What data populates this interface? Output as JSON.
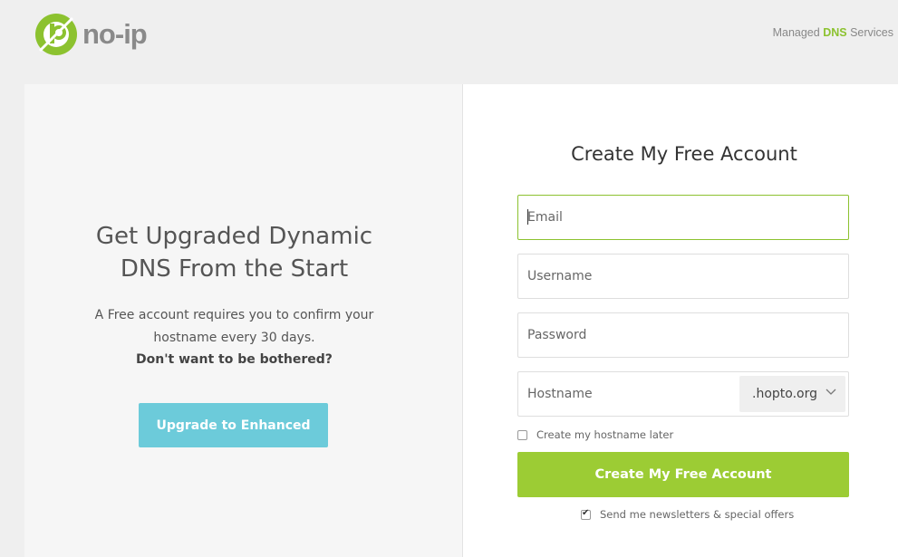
{
  "brand": {
    "logo_text": "no-ip",
    "logo_monogram": "ip"
  },
  "header": {
    "tagline_prefix": "Managed ",
    "tagline_highlight": "DNS",
    "tagline_suffix": " Services"
  },
  "promo": {
    "title_line1": "Get Upgraded Dynamic",
    "title_line2": "DNS From the Start",
    "desc_line1": "A Free account requires you to confirm your",
    "desc_line2": "hostname every 30 days.",
    "question": "Don't want to be bothered?",
    "upgrade_label": "Upgrade to Enhanced"
  },
  "signup": {
    "title": "Create My Free Account",
    "email": {
      "placeholder": "Email",
      "value": ""
    },
    "username": {
      "placeholder": "Username",
      "value": ""
    },
    "password": {
      "placeholder": "Password",
      "value": ""
    },
    "hostname": {
      "placeholder": "Hostname",
      "value": ""
    },
    "domain_selected": ".hopto.org",
    "hostname_later_label": "Create my hostname later",
    "hostname_later_checked": false,
    "submit_label": "Create My Free Account",
    "newsletter_label": "Send me newsletters & special offers",
    "newsletter_checked": true
  },
  "colors": {
    "accent_green": "#9ccc34",
    "upgrade_blue": "#6ccbda",
    "logo_green": "#8cc22f"
  },
  "icons": {
    "logo": "no-ip-logo-icon",
    "dropdown": "chevron-down-icon",
    "check": "checkmark-icon"
  }
}
